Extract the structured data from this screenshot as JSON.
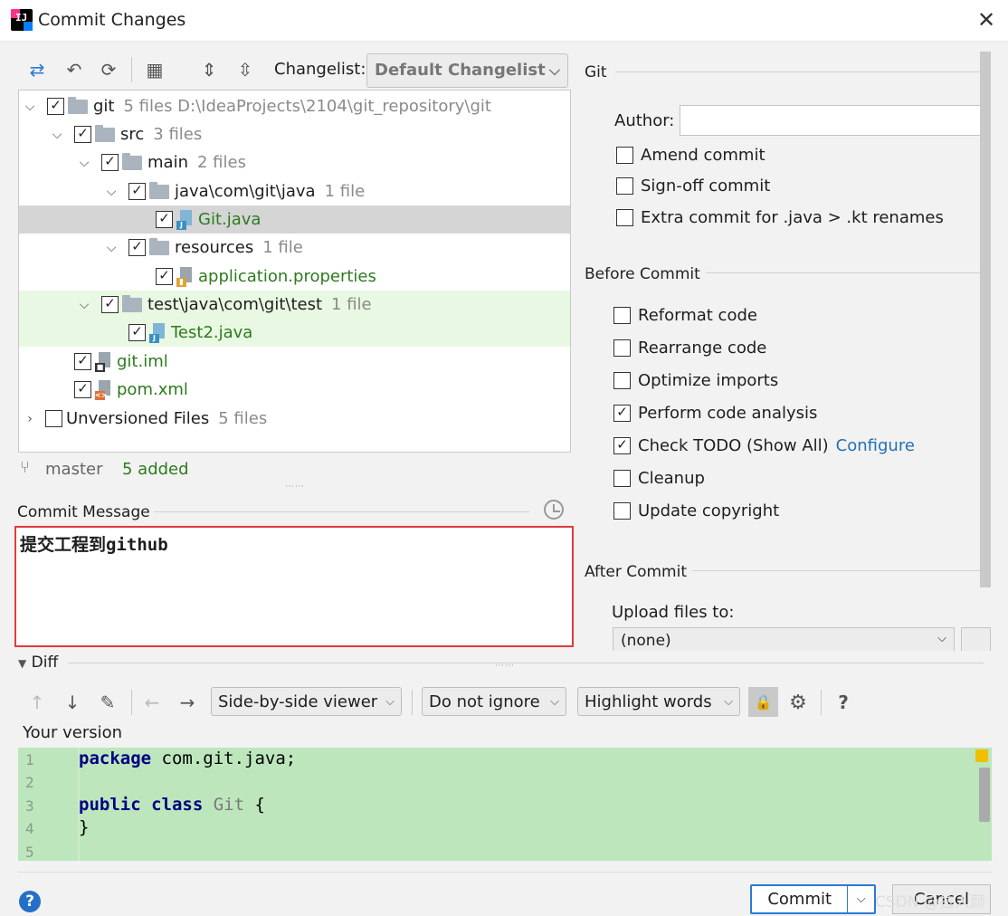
{
  "window": {
    "title": "Commit Changes"
  },
  "toolbar": {
    "changelist_label": "Changelist:",
    "changelist_value": "Default Changelist"
  },
  "tree": [
    {
      "name": "git",
      "meta": "5 files  D:\\IdeaProjects\\2104\\git_repository\\git",
      "type": "folder"
    },
    {
      "name": "src",
      "meta": "3 files",
      "type": "folder"
    },
    {
      "name": "main",
      "meta": "2 files",
      "type": "folder"
    },
    {
      "name": "java\\com\\git\\java",
      "meta": "1 file",
      "type": "folder"
    },
    {
      "name": "Git.java",
      "meta": "",
      "type": "java"
    },
    {
      "name": "resources",
      "meta": "1 file",
      "type": "folder"
    },
    {
      "name": "application.properties",
      "meta": "",
      "type": "props"
    },
    {
      "name": "test\\java\\com\\git\\test",
      "meta": "1 file",
      "type": "folder"
    },
    {
      "name": "Test2.java",
      "meta": "",
      "type": "java"
    },
    {
      "name": "git.iml",
      "meta": "",
      "type": "iml"
    },
    {
      "name": "pom.xml",
      "meta": "",
      "type": "xml"
    },
    {
      "name": "Unversioned Files",
      "meta": "5 files",
      "type": "group"
    }
  ],
  "status": {
    "branch": "master",
    "added": "5 added"
  },
  "commit_message": {
    "label": "Commit Message",
    "text": "提交工程到github"
  },
  "git": {
    "section": "Git",
    "author_label": "Author:",
    "author_value": "",
    "amend": "Amend commit",
    "signoff": "Sign-off commit",
    "extra": "Extra commit for .java > .kt renames"
  },
  "before_commit": {
    "section": "Before Commit",
    "reformat": "Reformat code",
    "rearrange": "Rearrange code",
    "optimize": "Optimize imports",
    "analysis": "Perform code analysis",
    "todo": "Check TODO (Show All)",
    "configure": "Configure",
    "cleanup": "Cleanup",
    "copyright": "Update copyright"
  },
  "after_commit": {
    "section": "After Commit",
    "upload_label": "Upload files to:",
    "upload_value": "(none)"
  },
  "diff": {
    "label": "Diff",
    "viewer": "Side-by-side viewer",
    "ignore": "Do not ignore",
    "highlight": "Highlight words",
    "your_version": "Your version",
    "line_numbers": [
      "1",
      "2",
      "3",
      "4",
      "5"
    ],
    "code": {
      "pkg_kw": "package",
      "pkg_rest": " com.git.java;",
      "pub_kw": "public class",
      "cls": " Git",
      "brace_open": " {",
      "brace_close": "}"
    }
  },
  "footer": {
    "commit": "Commit",
    "cancel": "Cancel",
    "watermark": "CSDN @拉人颜"
  }
}
